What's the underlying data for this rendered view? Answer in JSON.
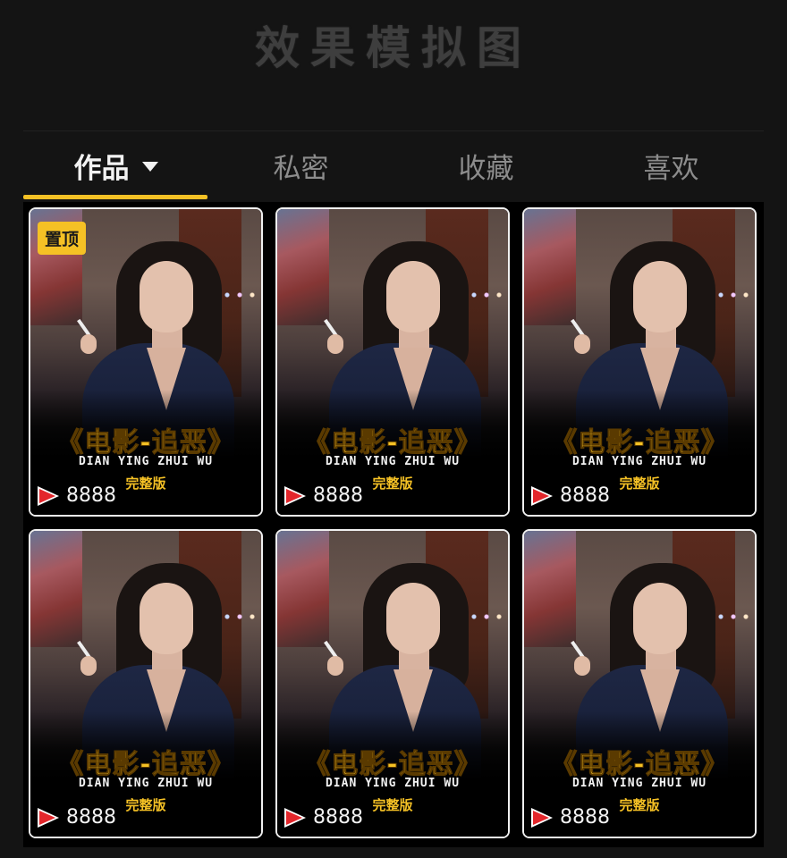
{
  "header": {
    "title": "效果模拟图"
  },
  "tabs": [
    {
      "label": "作品",
      "active": true,
      "has_dropdown": true
    },
    {
      "label": "私密",
      "active": false
    },
    {
      "label": "收藏",
      "active": false
    },
    {
      "label": "喜欢",
      "active": false
    }
  ],
  "colors": {
    "accent": "#f5c125",
    "background": "#141414",
    "play_red": "#e3262b"
  },
  "videos": [
    {
      "pinned": true,
      "pin_label": "置顶",
      "title": "《电影-追恶》",
      "pinyin": "DIAN YING ZHUI WU",
      "subtitle": "完整版",
      "play_count": "8888"
    },
    {
      "pinned": false,
      "title": "《电影-追恶》",
      "pinyin": "DIAN YING ZHUI WU",
      "subtitle": "完整版",
      "play_count": "8888"
    },
    {
      "pinned": false,
      "title": "《电影-追恶》",
      "pinyin": "DIAN YING ZHUI WU",
      "subtitle": "完整版",
      "play_count": "8888"
    },
    {
      "pinned": false,
      "title": "《电影-追恶》",
      "pinyin": "DIAN YING ZHUI WU",
      "subtitle": "完整版",
      "play_count": "8888"
    },
    {
      "pinned": false,
      "title": "《电影-追恶》",
      "pinyin": "DIAN YING ZHUI WU",
      "subtitle": "完整版",
      "play_count": "8888"
    },
    {
      "pinned": false,
      "title": "《电影-追恶》",
      "pinyin": "DIAN YING ZHUI WU",
      "subtitle": "完整版",
      "play_count": "8888"
    }
  ]
}
